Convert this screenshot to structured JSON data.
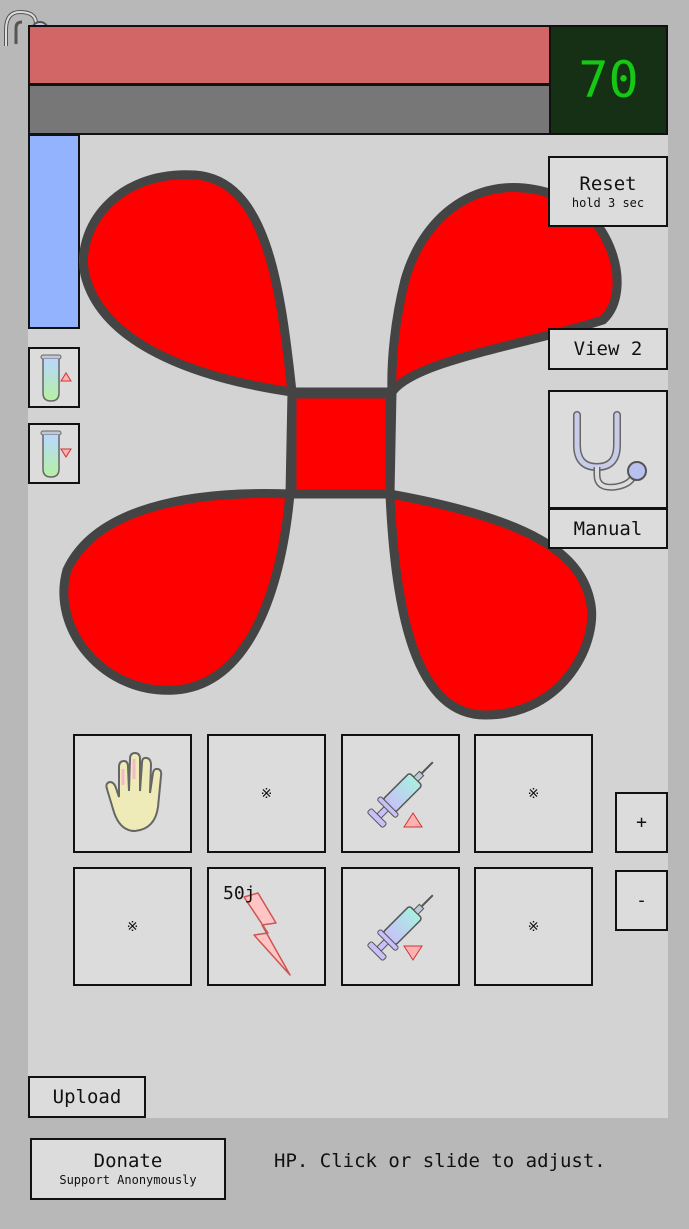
{
  "header": {
    "hp_value": "70"
  },
  "buttons": {
    "reset_label": "Reset",
    "reset_sub": "hold 3 sec",
    "view_label": "View 2",
    "manual_label": "Manual",
    "upload_label": "Upload",
    "donate_label": "Donate",
    "donate_sub": "Support Anonymously",
    "plus_label": "+",
    "minus_label": "-"
  },
  "tiles": {
    "empty_symbol": "※",
    "shock_energy": "50j"
  },
  "status_text": "HP. Click or slide to adjust.",
  "colors": {
    "hp_bar": "#d26565",
    "display_bg": "#163016",
    "display_text": "#14c814",
    "blue_bar": "#93b3ff",
    "clover_fill": "#ff0000",
    "clover_stroke": "#444444"
  },
  "icons": [
    "stethoscope-icon",
    "test-tube-up-icon",
    "test-tube-down-icon",
    "hand-icon",
    "syringe-up-icon",
    "syringe-down-icon",
    "lightning-icon"
  ]
}
